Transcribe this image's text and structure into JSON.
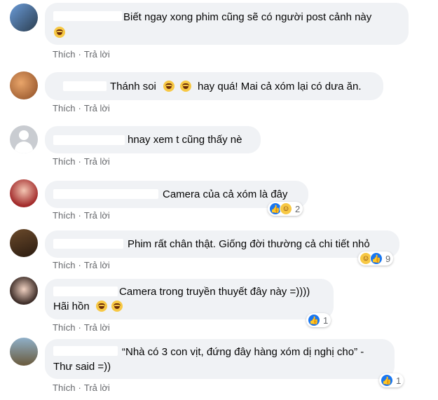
{
  "actions": {
    "like": "Thích",
    "reply": "Trả lời"
  },
  "comments": [
    {
      "text": "Biết ngay xong phim cũng sẽ có người post cảnh này",
      "emoji_line2": "laughing-emoji"
    },
    {
      "text_a": "Thánh soi",
      "text_b": "hay quá! Mai cả xóm lại có dưa ăn.",
      "emoji_prefix": "~"
    },
    {
      "text": "hnay xem t cũng thấy nè"
    },
    {
      "text": "Camera của cả xóm là đây",
      "reactions": {
        "icons": [
          "like-reaction",
          "haha-reaction"
        ],
        "count": "2"
      }
    },
    {
      "text": "Phim rất chân thật. Giống đời thường cả chi tiết nhỏ",
      "reactions": {
        "icons": [
          "haha-reaction",
          "like-reaction"
        ],
        "count": "9"
      }
    },
    {
      "text_line1": "Camera trong truyền thuyết đây này =))))",
      "text_line2": "Hãi hồn",
      "reactions": {
        "icons": [
          "like-reaction"
        ],
        "count": "1"
      }
    },
    {
      "text_line1": "“Nhà có 3 con vịt, đứng đây hàng xóm dị nghị cho” -",
      "text_line2": "Thư said =))",
      "reactions": {
        "icons": [
          "like-reaction"
        ],
        "count": "1"
      }
    }
  ],
  "colors": {
    "bubble": "#f0f2f5",
    "meta": "#65676b",
    "like": "#1877f2",
    "haha": "#f7c844"
  }
}
